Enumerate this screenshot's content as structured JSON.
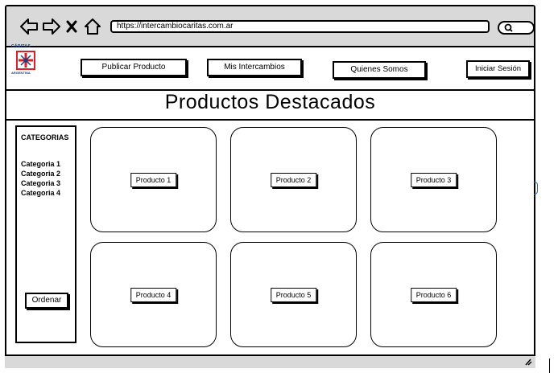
{
  "browser": {
    "url": "https://intercambiocaritas.com.ar"
  },
  "brand": {
    "logo_top_text": "CÁRITAS",
    "logo_bottom_text": "ARGENTINA",
    "logo_colors": {
      "red": "#d6202a",
      "blue": "#1d3d7a"
    }
  },
  "nav": {
    "items": [
      {
        "label": "Publicar Producto"
      },
      {
        "label": "Mis Intercambios"
      },
      {
        "label": "Quienes Somos"
      },
      {
        "label": "Iniciar Sesión"
      }
    ]
  },
  "page": {
    "title": "Productos Destacados"
  },
  "sidebar": {
    "title": "CATEGORIAS",
    "categories": [
      "Categoria 1",
      "Categoria 2",
      "Categoria 3",
      "Categoria 4"
    ],
    "sort_label": "Ordenar"
  },
  "products": [
    {
      "label": "Producto 1"
    },
    {
      "label": "Producto 2"
    },
    {
      "label": "Producto 3"
    },
    {
      "label": "Producto 4"
    },
    {
      "label": "Producto 5"
    },
    {
      "label": "Producto 6"
    }
  ],
  "icons": {
    "back": "arrow-left-icon",
    "forward": "arrow-right-icon",
    "stop": "close-icon",
    "home": "home-icon",
    "search": "search-icon",
    "resize": "resize-grip-icon"
  }
}
